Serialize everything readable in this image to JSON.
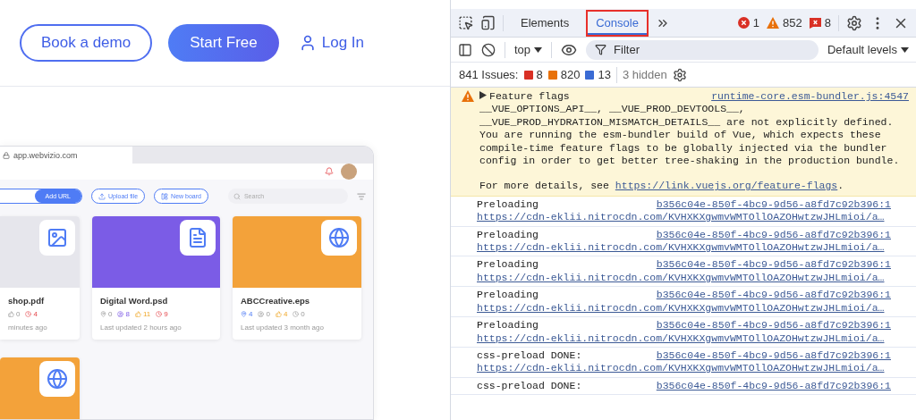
{
  "site_nav": {
    "buttons": [
      {
        "label": "Book a demo",
        "kind": "outline"
      },
      {
        "label": "Start Free",
        "kind": "filled"
      },
      {
        "label": "Log In",
        "kind": "link"
      }
    ]
  },
  "mockup": {
    "url": "app.webvizio.com",
    "add_url_button": "Add URL",
    "upload_button": "Upload file",
    "board_button": "New board",
    "search_placeholder": "Search",
    "cards": [
      {
        "name": "shop.pdf",
        "updated": "minutes ago",
        "kind": "image",
        "stats": [
          {
            "kind": "like",
            "count": "0",
            "active": false
          },
          {
            "kind": "clock",
            "count": "4",
            "active": true
          }
        ]
      },
      {
        "name": "Digital Word.psd",
        "updated": "Last updated 2 hours ago",
        "kind": "file",
        "stats": [
          {
            "kind": "pin",
            "count": "0",
            "active": false
          },
          {
            "kind": "user",
            "count": "8",
            "active": true
          },
          {
            "kind": "like",
            "count": "11",
            "active": true
          },
          {
            "kind": "clock",
            "count": "9",
            "active": true
          }
        ]
      },
      {
        "name": "ABCCreative.eps",
        "updated": "Last updated 3 month ago",
        "kind": "web",
        "stats": [
          {
            "kind": "pin",
            "count": "4",
            "active": true
          },
          {
            "kind": "user",
            "count": "0",
            "active": false
          },
          {
            "kind": "like",
            "count": "4",
            "active": true
          },
          {
            "kind": "clock",
            "count": "0",
            "active": false
          }
        ]
      },
      {
        "kind": "web"
      }
    ]
  },
  "devtools": {
    "tabs": [
      {
        "label": "Elements",
        "selected": false,
        "highlighted": false
      },
      {
        "label": "Console",
        "selected": true,
        "highlighted": true
      }
    ],
    "counters": [
      {
        "kind": "error",
        "count": "1"
      },
      {
        "kind": "warning",
        "count": "852"
      },
      {
        "kind": "issue",
        "count": "8"
      }
    ],
    "context": "top",
    "filter_placeholder": "Filter",
    "levels": "Default levels",
    "issues_label": "841 Issues:",
    "issues": [
      {
        "kind": "error",
        "count": "8"
      },
      {
        "kind": "warning",
        "count": "820"
      },
      {
        "kind": "info",
        "count": "13"
      }
    ],
    "hidden": "3 hidden",
    "messages": [
      {
        "kind": "warning",
        "title": "Feature flags",
        "source": "runtime-core.esm-bundler.js:4547",
        "body": "__VUE_OPTIONS_API__, __VUE_PROD_DEVTOOLS__, __VUE_PROD_HYDRATION_MISMATCH_DETAILS__ are not explicitly defined. You are running the esm-bundler build of Vue, which expects these compile-time feature flags to be globally injected via the bundler config in order to get better tree-shaking in the production bundle.",
        "details": "For more details, see ",
        "link": "https://link.vuejs.org/feature-flags",
        "trail": "."
      },
      {
        "kind": "log",
        "title": "Preloading",
        "source": "b356c04e-850f-4bc9-9d56-a8fd7c92b396:1",
        "url": "https://cdn-eklii.nitrocdn.com/KVHXKXgwmvWMTOllOAZOHwtzwJHLmioi/a…"
      },
      {
        "kind": "log",
        "title": "Preloading",
        "source": "b356c04e-850f-4bc9-9d56-a8fd7c92b396:1",
        "url": "https://cdn-eklii.nitrocdn.com/KVHXKXgwmvWMTOllOAZOHwtzwJHLmioi/a…"
      },
      {
        "kind": "log",
        "title": "Preloading",
        "source": "b356c04e-850f-4bc9-9d56-a8fd7c92b396:1",
        "url": "https://cdn-eklii.nitrocdn.com/KVHXKXgwmvWMTOllOAZOHwtzwJHLmioi/a…"
      },
      {
        "kind": "log",
        "title": "Preloading",
        "source": "b356c04e-850f-4bc9-9d56-a8fd7c92b396:1",
        "url": "https://cdn-eklii.nitrocdn.com/KVHXKXgwmvWMTOllOAZOHwtzwJHLmioi/a…"
      },
      {
        "kind": "log",
        "title": "Preloading",
        "source": "b356c04e-850f-4bc9-9d56-a8fd7c92b396:1",
        "url": "https://cdn-eklii.nitrocdn.com/KVHXKXgwmvWMTOllOAZOHwtzwJHLmioi/a…"
      },
      {
        "kind": "log",
        "title": "css-preload DONE:",
        "source": "b356c04e-850f-4bc9-9d56-a8fd7c92b396:1",
        "url": "https://cdn-eklii.nitrocdn.com/KVHXKXgwmvWMTOllOAZOHwtzwJHLmioi/a…"
      },
      {
        "kind": "log",
        "title": "css-preload DONE:",
        "source": "b356c04e-850f-4bc9-9d56-a8fd7c92b396:1"
      }
    ]
  }
}
